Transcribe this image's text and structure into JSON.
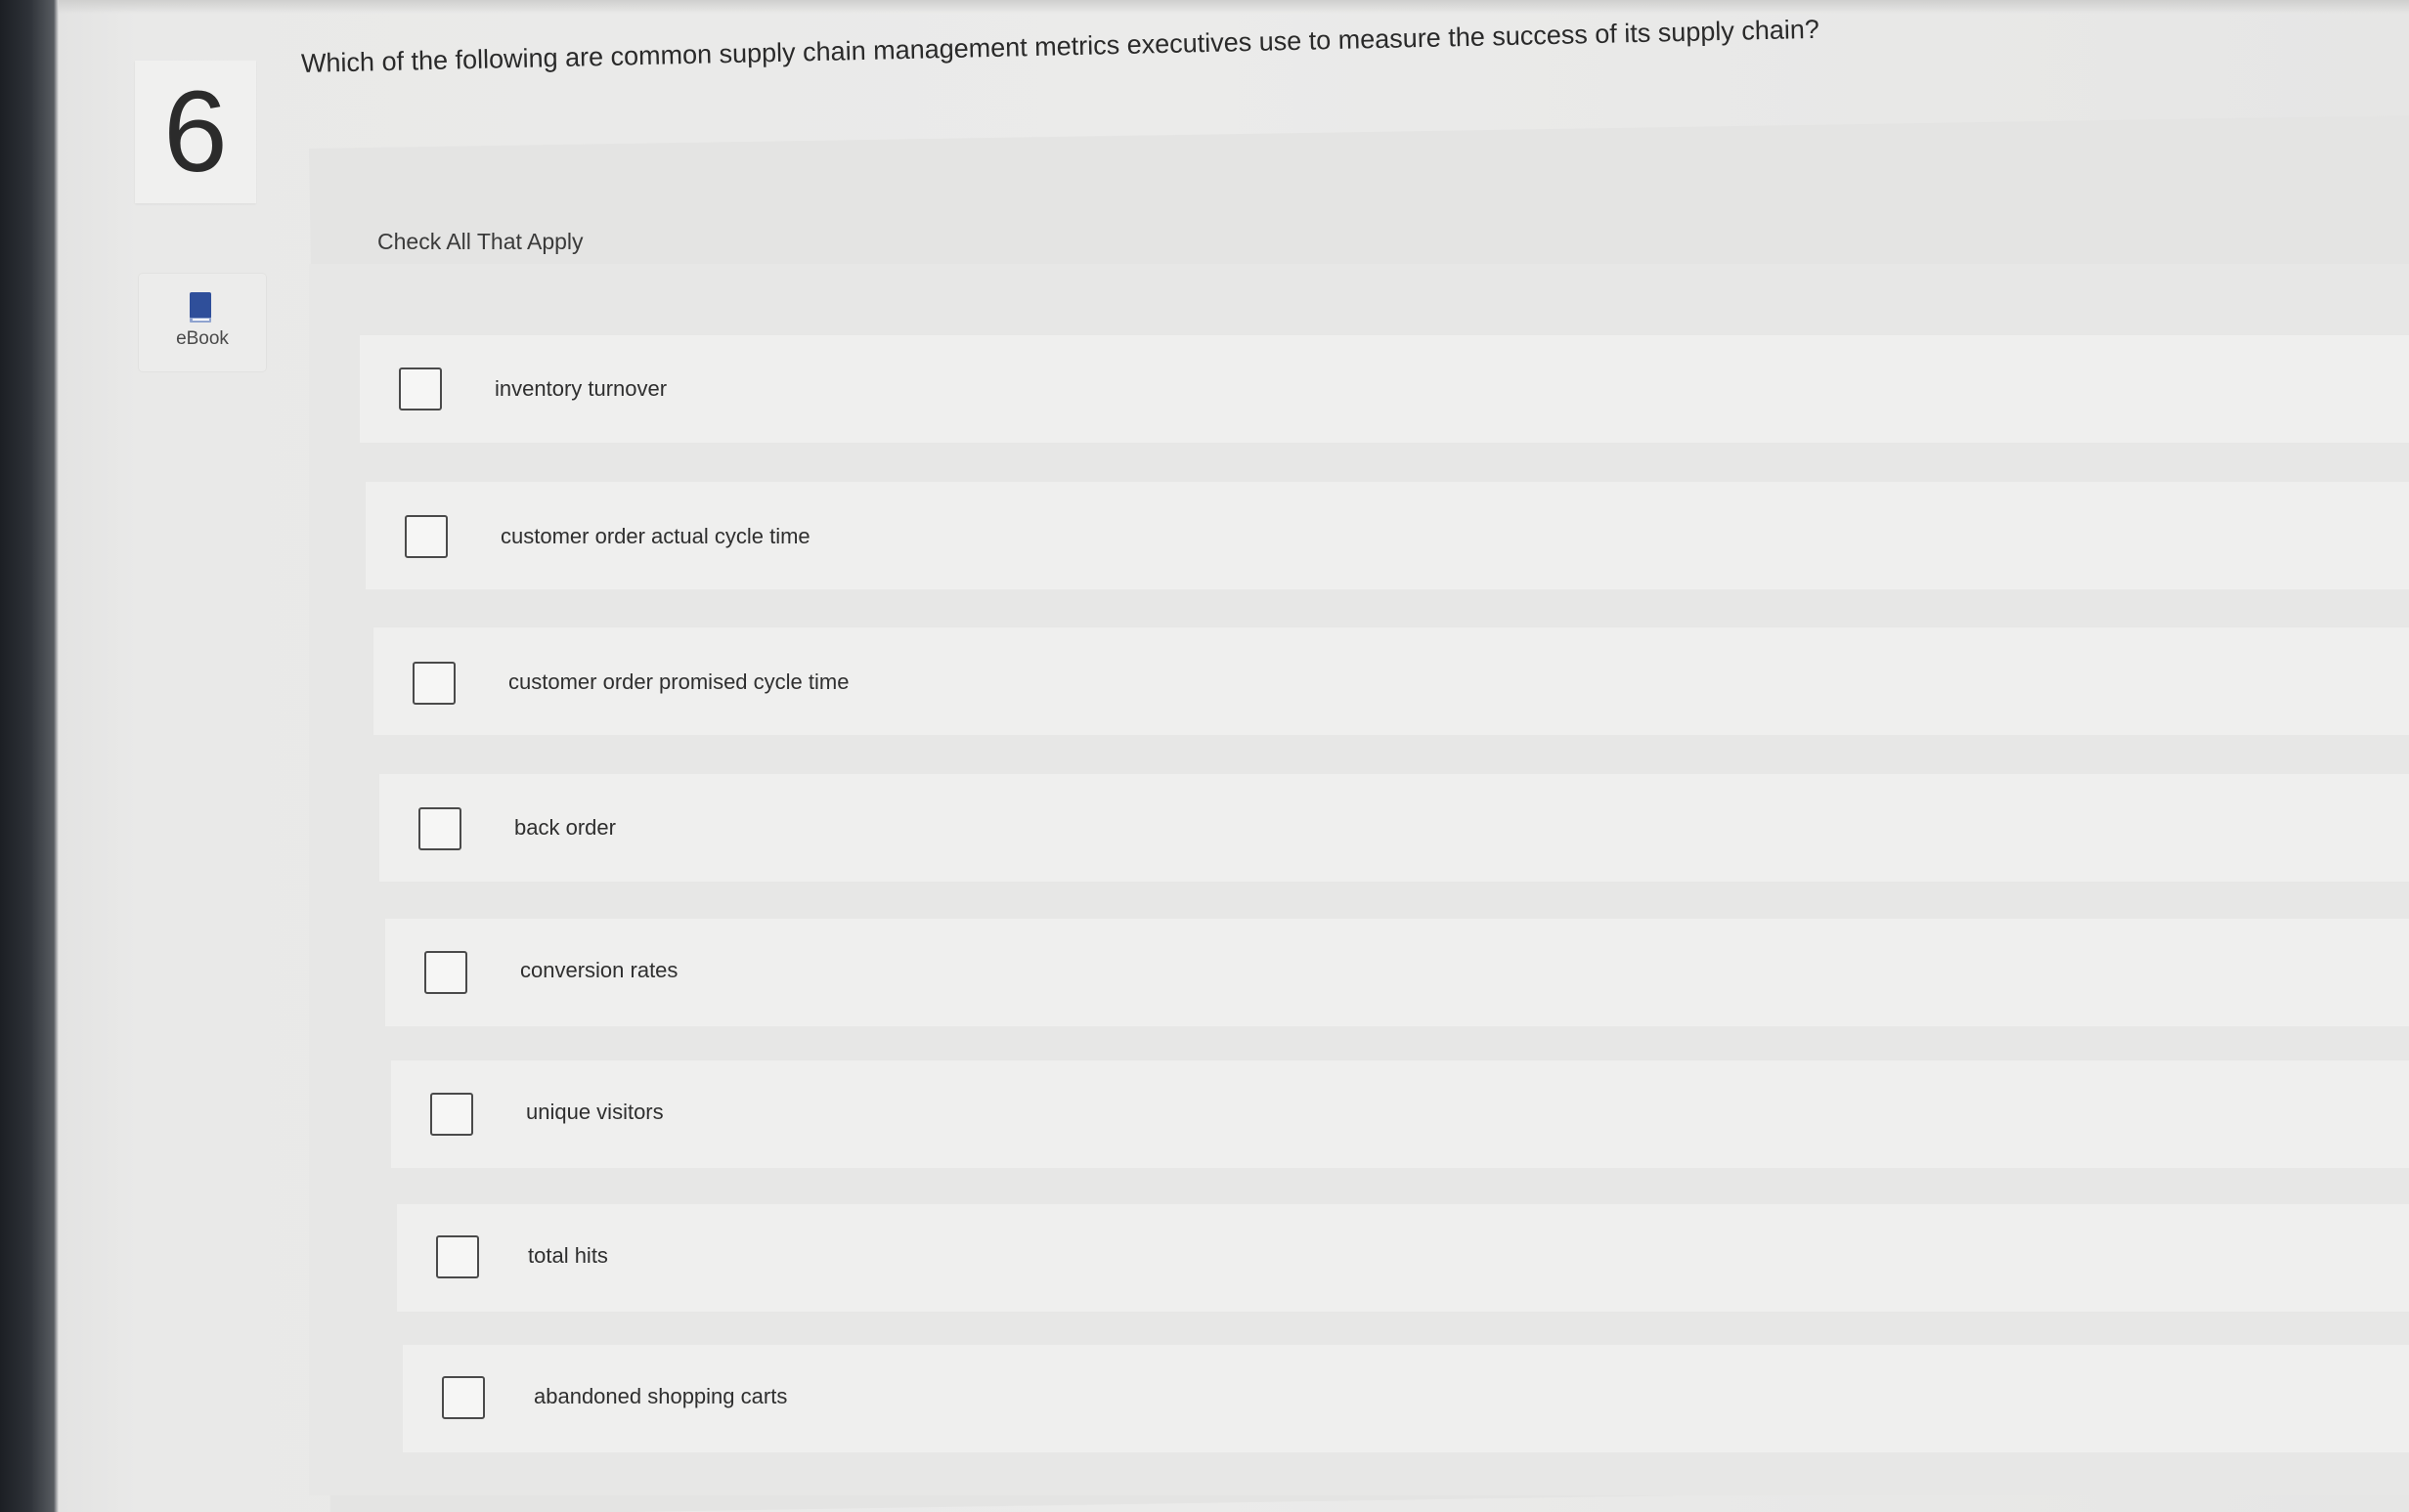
{
  "question": {
    "number": "6",
    "text": "Which of the following are common supply chain management metrics executives use to measure the success of its supply chain?",
    "instruction": "Check All That Apply"
  },
  "sidebar": {
    "ebook_label": "eBook",
    "ebook_icon": "book-icon"
  },
  "options": [
    {
      "label": "inventory turnover",
      "checked": false
    },
    {
      "label": "customer order actual cycle time",
      "checked": false
    },
    {
      "label": "customer order promised cycle time",
      "checked": false
    },
    {
      "label": "back order",
      "checked": false
    },
    {
      "label": "conversion rates",
      "checked": false
    },
    {
      "label": "unique visitors",
      "checked": false
    },
    {
      "label": "total hits",
      "checked": false
    },
    {
      "label": "abandoned shopping carts",
      "checked": false
    }
  ],
  "colors": {
    "ebook_icon": "#2f4f9a",
    "checkbox_border": "#4a4a4a"
  }
}
